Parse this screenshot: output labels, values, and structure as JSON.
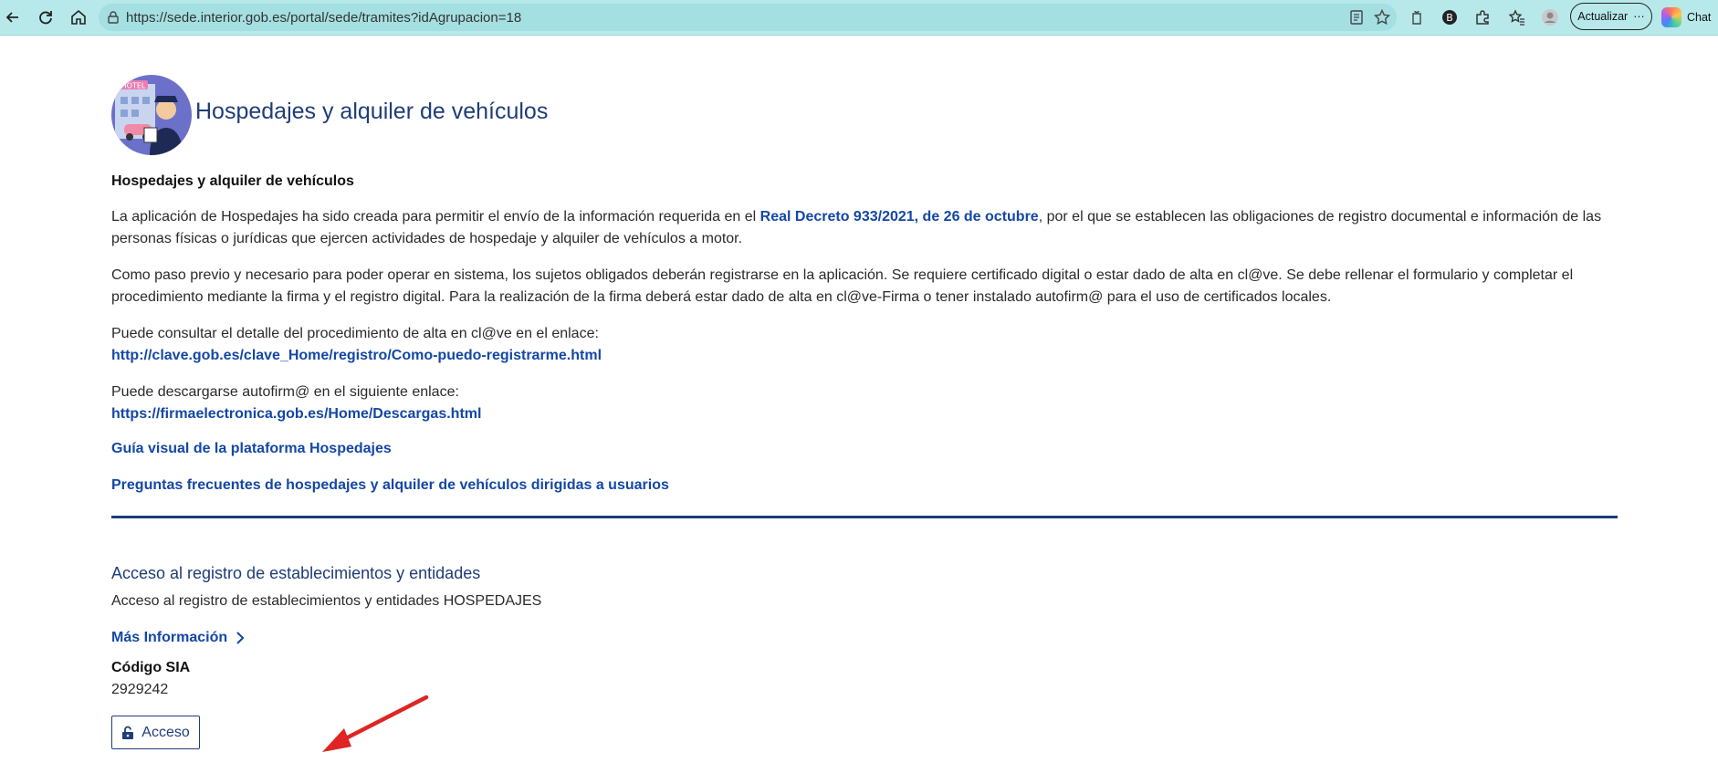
{
  "browser": {
    "url": "https://sede.interior.gob.es/portal/sede/tramites?idAgrupacion=18",
    "update_label": "Actualizar",
    "update_more": "···",
    "chat_label": "Chat"
  },
  "page": {
    "hero_title": "Hospedajes y alquiler de vehículos",
    "section_heading": "Hospedajes y alquiler de vehículos",
    "para1_before": "La aplicación de Hospedajes ha sido creada para permitir el envío de la información requerida en el ",
    "para1_link": "Real Decreto 933/2021, de 26 de octubre",
    "para1_after": ", por el que se establecen las obligaciones de registro documental e información de las personas físicas o jurídicas que ejercen actividades de hospedaje y alquiler de vehículos a motor.",
    "para2": "Como paso previo y necesario para poder operar en sistema, los sujetos obligados deberán registrarse en la aplicación. Se requiere certificado digital o estar dado de alta en cl@ve. Se debe rellenar el formulario y completar el procedimiento mediante la firma y el registro digital. Para la realización de la firma deberá estar dado de alta en cl@ve-Firma o tener instalado autofirm@ para el uso de certificados locales.",
    "para3": "Puede consultar el detalle del procedimiento de alta en cl@ve en el enlace:",
    "link_clave": "http://clave.gob.es/clave_Home/registro/Como-puedo-registrarme.html",
    "para4": "Puede descargarse autofirm@ en el siguiente enlace:",
    "link_autofirma": "https://firmaelectronica.gob.es/Home/Descargas.html",
    "link_guia": "Guía visual de la plataforma Hospedajes",
    "link_faq": "Preguntas frecuentes de hospedajes y alquiler de vehículos dirigidas a usuarios"
  },
  "access": {
    "title": "Acceso al registro de establecimientos y entidades",
    "description": "Acceso al registro de establecimientos y entidades HOSPEDAJES",
    "more_info": "Más Información",
    "sia_label": "Código SIA",
    "sia_value": "2929242",
    "button_label": "Acceso"
  },
  "hero_image": {
    "sign_text": "HOTEL"
  },
  "icons": [
    "back-icon",
    "reload-icon",
    "home-icon",
    "lock-icon",
    "reader-icon",
    "star-icon",
    "extension-icon",
    "favorites-icon",
    "profile-icon",
    "copilot-icon",
    "chevron-right-icon",
    "unlock-icon",
    "red-arrow"
  ],
  "colors": {
    "link": "#1447a6",
    "heading": "#1f3d78",
    "divider": "#1d3a74",
    "toolbar": "#b7e9ea",
    "arrow": "#e02424"
  }
}
